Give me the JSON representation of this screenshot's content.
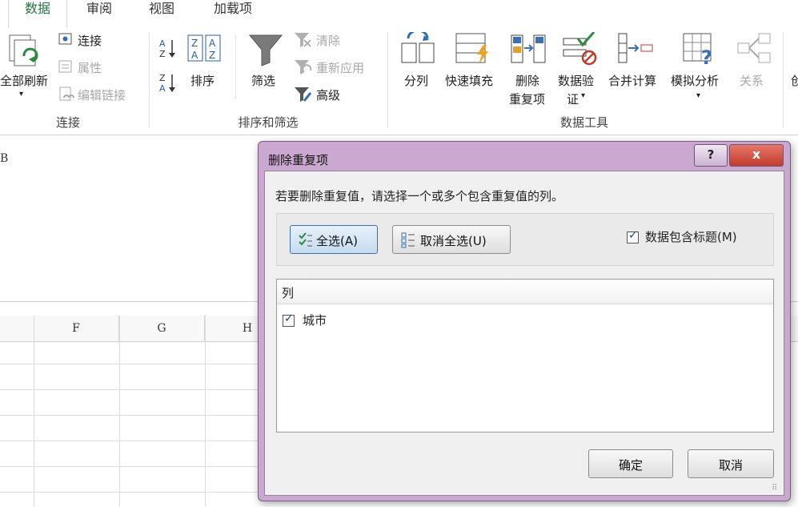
{
  "tabs": [
    {
      "label": "数据",
      "active": true
    },
    {
      "label": "审阅"
    },
    {
      "label": "视图"
    },
    {
      "label": "加载项"
    }
  ],
  "ribbon": {
    "connections": {
      "refresh_all": "全部刷新",
      "connect": "连接",
      "properties": "属性",
      "edit_links": "编辑链接",
      "group_label": "连接"
    },
    "sort_filter": {
      "sort": "排序",
      "filter": "筛选",
      "clear": "清除",
      "reapply": "重新应用",
      "advanced": "高级",
      "group_label": "排序和筛选"
    },
    "data_tools": {
      "text_to_columns": "分列",
      "flash_fill": "快速填充",
      "remove_dup_line1": "删除",
      "remove_dup_line2": "重复项",
      "validation_line1": "数据验",
      "validation_line2": "证",
      "consolidate": "合并计算",
      "what_if": "模拟分析",
      "relationships": "关系",
      "group_label": "数据工具"
    },
    "partial_right": "创"
  },
  "sheet": {
    "partial_cell_text": "B",
    "columns": [
      "F",
      "G",
      "H"
    ]
  },
  "dialog": {
    "title": "删除重复项",
    "help": "?",
    "close": "x",
    "instruction": "若要删除重复值，请选择一个或多个包含重复值的列。",
    "select_all": "全选(A)",
    "unselect_all": "取消全选(U)",
    "has_headers": "数据包含标题(M)",
    "list_header": "列",
    "items": [
      {
        "label": "城市",
        "checked": true
      }
    ],
    "ok": "确定",
    "cancel": "取消"
  },
  "colors": {
    "accent_green": "#217346",
    "dialog_frame": "#c9a9cf"
  }
}
